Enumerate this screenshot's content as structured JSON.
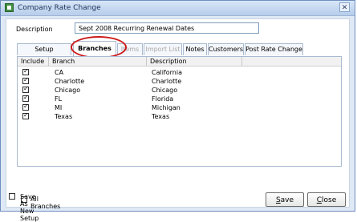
{
  "window": {
    "title": "Company Rate Change",
    "close_symbol": "✕"
  },
  "form": {
    "description_label": "Description",
    "description_value": "Sept 2008 Recurring Renewal Dates"
  },
  "tabs": [
    {
      "label": "Setup Information",
      "state": "normal"
    },
    {
      "label": "Branches",
      "state": "active"
    },
    {
      "label": "Items",
      "state": "disabled"
    },
    {
      "label": "Import List",
      "state": "disabled"
    },
    {
      "label": "Notes",
      "state": "normal"
    },
    {
      "label": "Customers",
      "state": "normal"
    },
    {
      "label": "Post Rate Change",
      "state": "normal"
    }
  ],
  "grid": {
    "headers": [
      "Include",
      "Branch",
      "Description"
    ],
    "rows": [
      {
        "include": true,
        "branch": "CA",
        "description": "California"
      },
      {
        "include": true,
        "branch": "Charlotte",
        "description": "Charlotte"
      },
      {
        "include": true,
        "branch": "Chicago",
        "description": "Chicago"
      },
      {
        "include": true,
        "branch": "FL",
        "description": "Florida"
      },
      {
        "include": true,
        "branch": "MI",
        "description": "Michigan"
      },
      {
        "include": true,
        "branch": "Texas",
        "description": "Texas"
      }
    ]
  },
  "options": {
    "all_branches_label": "All Branches",
    "all_branches_checked": false,
    "save_as_new_label": "Save As New Setup",
    "save_as_new_checked": false
  },
  "buttons": {
    "save_label": "Save",
    "close_label": "Close"
  },
  "colors": {
    "annotation_ellipse": "#cc1a1a",
    "title_bar": "#b7cdea"
  }
}
